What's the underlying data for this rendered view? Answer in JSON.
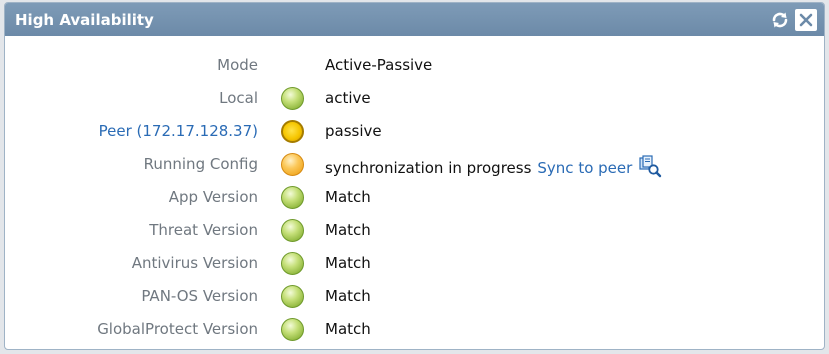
{
  "header": {
    "title": "High Availability",
    "refresh_icon": "refresh-icon",
    "close_icon": "close-icon"
  },
  "rows": [
    {
      "label": "Mode",
      "value": "Active-Passive",
      "status": null
    },
    {
      "label": "Local",
      "value": "active",
      "status": "green"
    },
    {
      "label": "Peer",
      "ip": "172.17.128.37",
      "value": "passive",
      "status": "yellow"
    },
    {
      "label": "Running Config",
      "value": "synchronization in progress",
      "status": "orange",
      "link": "Sync to peer",
      "link_icon": "sync-peer-icon"
    },
    {
      "label": "App Version",
      "value": "Match",
      "status": "green"
    },
    {
      "label": "Threat Version",
      "value": "Match",
      "status": "green"
    },
    {
      "label": "Antivirus Version",
      "value": "Match",
      "status": "green"
    },
    {
      "label": "PAN-OS Version",
      "value": "Match",
      "status": "green"
    },
    {
      "label": "GlobalProtect Version",
      "value": "Match",
      "status": "green"
    }
  ],
  "colors": {
    "header": "#6c8aa8",
    "link": "#2a6bb5",
    "status_green": "#8eb63c",
    "status_yellow": "#f6c600",
    "status_orange": "#f0a51d"
  }
}
